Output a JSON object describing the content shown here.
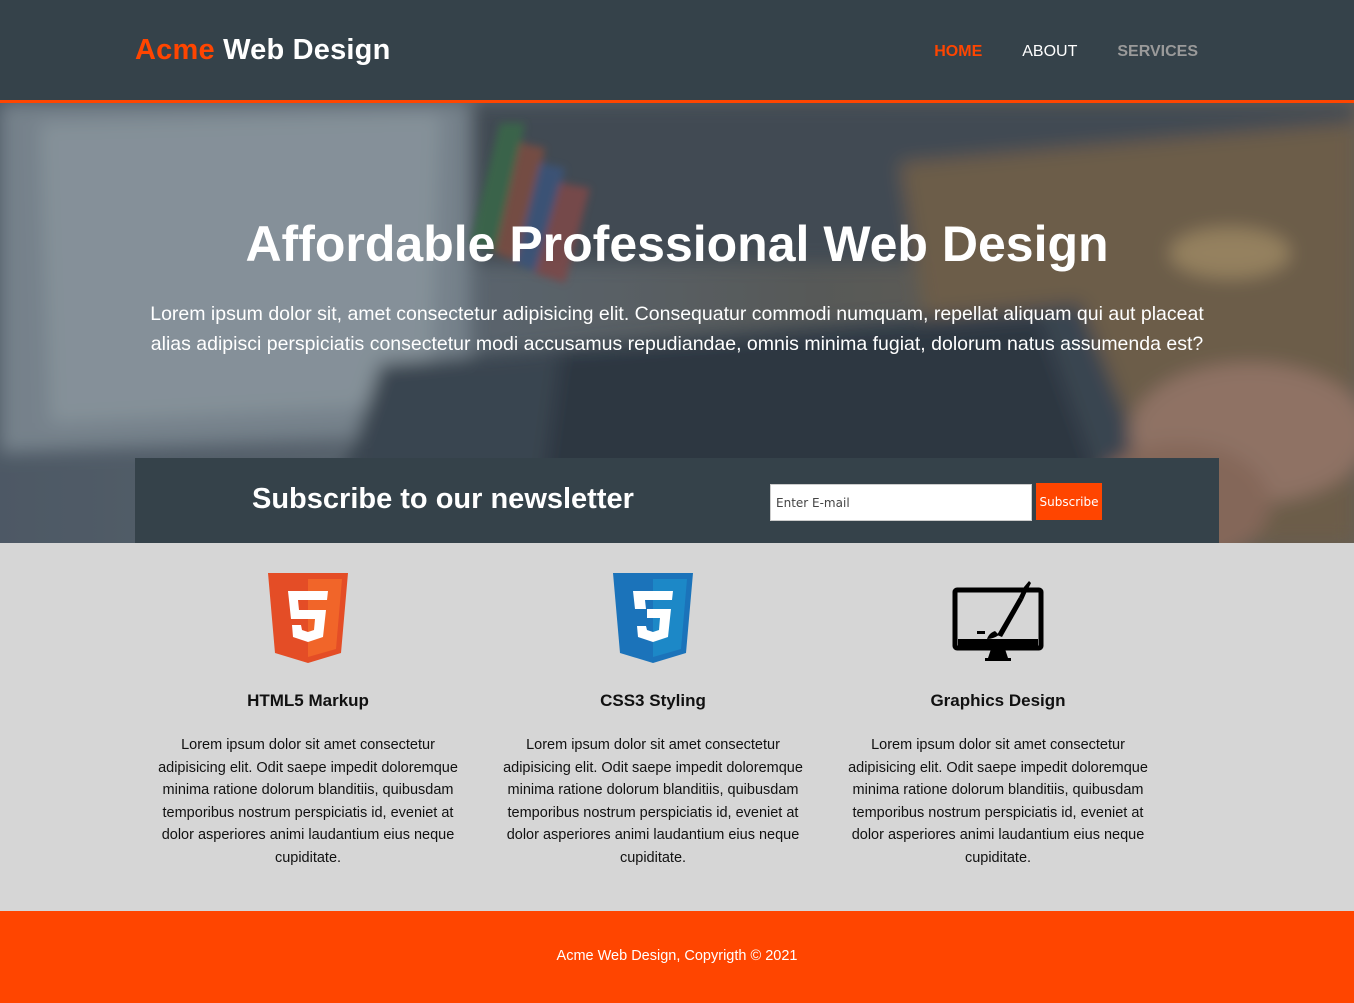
{
  "header": {
    "logo_highlight": "Acme",
    "logo_rest": "Web Design",
    "nav": [
      {
        "label": "HOME"
      },
      {
        "label": "ABOUT"
      },
      {
        "label": "SERVICES"
      }
    ]
  },
  "hero": {
    "title": "Affordable Professional Web Design",
    "text": "Lorem ipsum dolor sit, amet consectetur adipisicing elit. Consequatur commodi numquam, repellat aliquam qui aut placeat alias adipisci perspiciatis consectetur modi accusamus repudiandae, omnis minima fugiat, dolorum natus assumenda est?"
  },
  "newsletter": {
    "title": "Subscribe to our newsletter",
    "placeholder": "Enter E-mail",
    "button": "Subscribe"
  },
  "features": [
    {
      "icon": "html5-icon",
      "title": "HTML5 Markup",
      "text": "Lorem ipsum dolor sit amet consectetur adipisicing elit. Odit saepe impedit doloremque minima ratione dolorum blanditiis, quibusdam temporibus nostrum perspiciatis id, eveniet at dolor asperiores animi laudantium eius neque cupiditate."
    },
    {
      "icon": "css3-icon",
      "title": "CSS3 Styling",
      "text": "Lorem ipsum dolor sit amet consectetur adipisicing elit. Odit saepe impedit doloremque minima ratione dolorum blanditiis, quibusdam temporibus nostrum perspiciatis id, eveniet at dolor asperiores animi laudantium eius neque cupiditate."
    },
    {
      "icon": "monitor-brush-icon",
      "title": "Graphics Design",
      "text": "Lorem ipsum dolor sit amet consectetur adipisicing elit. Odit saepe impedit doloremque minima ratione dolorum blanditiis, quibusdam temporibus nostrum perspiciatis id, eveniet at dolor asperiores animi laudantium eius neque cupiditate."
    }
  ],
  "footer": {
    "text": "Acme Web Design, Copyrigth © 2021"
  },
  "colors": {
    "accent": "#ff4500",
    "dark": "#35424a",
    "light_bg": "#d6d6d6"
  }
}
